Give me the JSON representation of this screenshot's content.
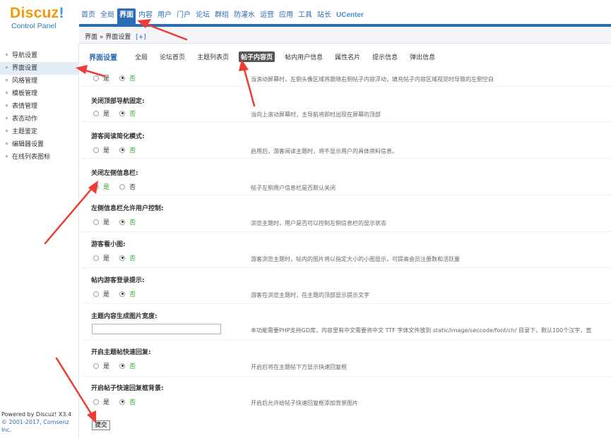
{
  "logo": {
    "main": "Discuz",
    "bang": "!",
    "sub": "Control Panel"
  },
  "topnav": [
    {
      "label": "首页",
      "active": false
    },
    {
      "label": "全局",
      "active": false
    },
    {
      "label": "界面",
      "active": true
    },
    {
      "label": "内容",
      "active": false
    },
    {
      "label": "用户",
      "active": false
    },
    {
      "label": "门户",
      "active": false
    },
    {
      "label": "论坛",
      "active": false
    },
    {
      "label": "群组",
      "active": false
    },
    {
      "label": "防灌水",
      "active": false
    },
    {
      "label": "运营",
      "active": false
    },
    {
      "label": "应用",
      "active": false
    },
    {
      "label": "工具",
      "active": false
    },
    {
      "label": "站长",
      "active": false
    },
    {
      "label": "UCenter",
      "active": false
    }
  ],
  "breadcrumb": {
    "text": "界面 » 界面设置",
    "plus": "[+]"
  },
  "sidebar": {
    "items": [
      {
        "label": "导航设置",
        "active": false
      },
      {
        "label": "界面设置",
        "active": true
      },
      {
        "label": "风格管理",
        "active": false
      },
      {
        "label": "模板管理",
        "active": false
      },
      {
        "label": "表情管理",
        "active": false
      },
      {
        "label": "表态动作",
        "active": false
      },
      {
        "label": "主题鉴定",
        "active": false
      },
      {
        "label": "编辑器设置",
        "active": false
      },
      {
        "label": "在线列表图标",
        "active": false
      }
    ],
    "footer_powered": "Powered by Discuz! X3.4",
    "footer_company": "© 2001-2017, Comsenz Inc."
  },
  "tabs": {
    "title": "界面设置",
    "items": [
      {
        "label": "全局",
        "active": false
      },
      {
        "label": "论坛首页",
        "active": false
      },
      {
        "label": "主题列表页",
        "active": false
      },
      {
        "label": "帖子内容页",
        "active": true
      },
      {
        "label": "帖内用户信息",
        "active": false
      },
      {
        "label": "属性名片",
        "active": false
      },
      {
        "label": "提示信息",
        "active": false
      },
      {
        "label": "弹出信息",
        "active": false
      }
    ]
  },
  "options": {
    "yes": "是",
    "no": "否"
  },
  "settings": [
    {
      "label": "",
      "selected": "no",
      "desc": "当滚动屏幕时，左侧头像区域将跟随右侧帖子内容浮动，填充帖子内容区域视觉时导致的左侧空白"
    },
    {
      "label": "关闭顶部导航固定:",
      "selected": "no",
      "desc": "当向上滚动屏幕时，主导航将即时出现在屏幕的顶部"
    },
    {
      "label": "游客阅读简化模式:",
      "selected": "no",
      "desc": "启用后，游客阅读主题时，将不显示用户的具体资料信息。"
    },
    {
      "label": "关闭左侧信息栏:",
      "selected": "yes",
      "desc": "帖子左侧用户信息栏是否默认关闭"
    },
    {
      "label": "左侧信息栏允许用户控制:",
      "selected": "no",
      "desc": "浏览主题时，用户是否可以控制左侧信息栏的显示状态"
    },
    {
      "label": "游客看小图:",
      "selected": "no",
      "desc": "游客浏览主题时，帖内的图片将以指定大小的小图显示，可提高会员注册数和活跃量"
    },
    {
      "label": "帖内游客登录提示:",
      "selected": "no",
      "desc": "游客在浏览主题时，在主题的顶部显示提示文字"
    },
    {
      "label": "主题内容生成图片宽度:",
      "input": true,
      "value": "",
      "desc": "本功能需要PHP支持GD库，内容里有中文需要将中文 TTF 字体文件放到 static/image/seccode/font/ch/ 目录下，默认100个汉字，宽"
    },
    {
      "label": "开启主题帖快速回复:",
      "selected": "no",
      "desc": "开启后将在主题帖下方显示快速回复框"
    },
    {
      "label": "开启帖子快速回复框背景:",
      "selected": "no",
      "desc": "开启后允许给帖子快速回复框添加背景图片"
    }
  ],
  "submit_label": "提交",
  "arrow_color": "#ee3b33"
}
